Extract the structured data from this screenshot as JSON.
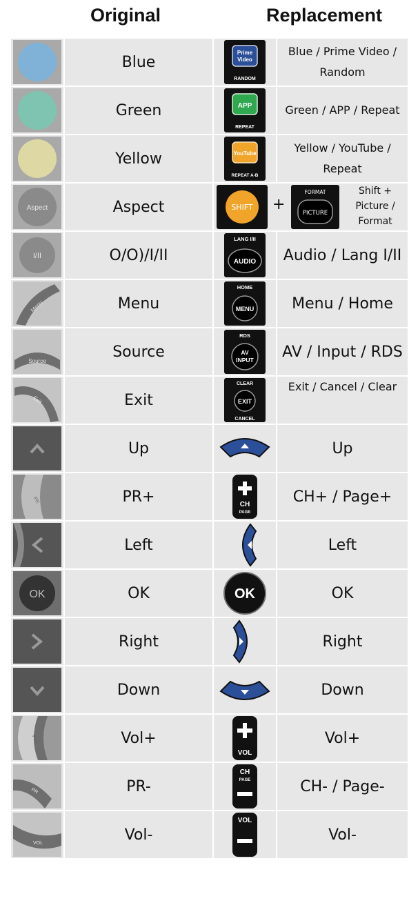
{
  "headers": {
    "original": "Original",
    "replacement": "Replacement"
  },
  "rows": [
    {
      "original": "Blue",
      "replacement": "Blue / Prime Video / Random"
    },
    {
      "original": "Green",
      "replacement": "Green / APP / Repeat"
    },
    {
      "original": "Yellow",
      "replacement": "Yellow / YouTube / Repeat"
    },
    {
      "original": "Aspect",
      "replacement": "Shift + Picture / Format"
    },
    {
      "original": "O/O)/I/II",
      "replacement": "Audio / Lang I/II"
    },
    {
      "original": "Menu",
      "replacement": "Menu / Home"
    },
    {
      "original": "Source",
      "replacement": "AV / Input / RDS"
    },
    {
      "original": "Exit",
      "replacement": "Exit / Cancel / Clear"
    },
    {
      "original": "Up",
      "replacement": "Up"
    },
    {
      "original": "PR+",
      "replacement": "CH+ / Page+"
    },
    {
      "original": "Left",
      "replacement": "Left"
    },
    {
      "original": "OK",
      "replacement": "OK"
    },
    {
      "original": "Right",
      "replacement": "Right"
    },
    {
      "original": "Down",
      "replacement": "Down"
    },
    {
      "original": "Vol+",
      "replacement": "Vol+"
    },
    {
      "original": "PR-",
      "replacement": "CH- / Page-"
    },
    {
      "original": "Vol-",
      "replacement": "Vol-"
    }
  ],
  "shift_row": {
    "plus": "+"
  },
  "button_text": {
    "prime_top": "Prime",
    "prime_bottom": "Video",
    "random": "RANDOM",
    "app": "APP",
    "repeat": "REPEAT",
    "youtube": "YouTube",
    "repeat_ab": "REPEAT A-B",
    "shift": "SHIFT",
    "format": "FORMAT",
    "picture": "PICTURE",
    "lang": "LANG I/II",
    "audio": "AUDIO",
    "home": "HOME",
    "menu": "MENU",
    "rds": "RDS",
    "av": "AV",
    "input": "INPUT",
    "clear": "CLEAR",
    "exit": "EXIT",
    "cancel": "CANCEL",
    "ch": "CH",
    "page": "PAGE",
    "ok": "OK",
    "vol": "VOL",
    "orig_aspect": "Aspect",
    "orig_audio": "I/II",
    "orig_menu": "Menu",
    "orig_source": "Source",
    "orig_exit": "Exit",
    "orig_pr": "PR",
    "orig_vol": "VOL",
    "orig_ok": "OK"
  },
  "colors": {
    "blue": "#7fb2d6",
    "green": "#7fc4b0",
    "yellow": "#ddd8a4",
    "accent_blue": "#2c4f9a",
    "grey": "#8a8a8a"
  }
}
